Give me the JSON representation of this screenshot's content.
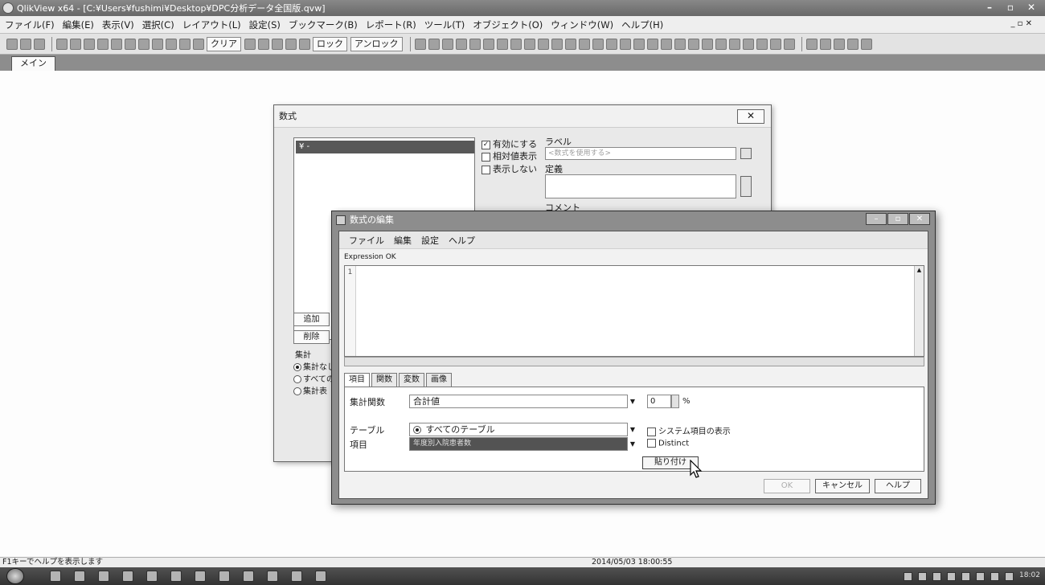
{
  "app": {
    "title": "QlikView x64 - [C:¥Users¥fushimi¥Desktop¥DPC分析データ全国版.qvw]",
    "window_controls": [
      "–",
      "▫",
      "✕"
    ],
    "mdi_controls": "_ ▫ ✕"
  },
  "menu": [
    "ファイル(F)",
    "編集(E)",
    "表示(V)",
    "選択(C)",
    "レイアウト(L)",
    "設定(S)",
    "ブックマーク(B)",
    "レポート(R)",
    "ツール(T)",
    "オブジェクト(O)",
    "ウィンドウ(W)",
    "ヘルプ(H)"
  ],
  "toolbar": {
    "clear_label": "クリア",
    "lock_label": "ロック",
    "unlock_label": "アンロック"
  },
  "sheet_tabs": [
    "メイン"
  ],
  "bg_dialog": {
    "title": "数式",
    "close_label": "✕",
    "list_item": "¥ -",
    "enable_label": "有効にする",
    "relative_label": "相対値表示",
    "hide_label": "表示しない",
    "label_caption": "ラベル",
    "label_placeholder": "<数式を使用する>",
    "definition_caption": "定義",
    "comment_caption": "コメント",
    "add_button": "追加",
    "delete_button": "削除",
    "total_mode_caption": "集計",
    "total_modes": [
      "集計なし",
      "すべての",
      "集計表"
    ]
  },
  "fg_dialog": {
    "title": "数式の編集",
    "menu": [
      "ファイル",
      "編集",
      "設定",
      "ヘルプ"
    ],
    "status": "Expression OK",
    "line_number": "1",
    "tabs": [
      "項目",
      "関数",
      "変数",
      "画像"
    ],
    "aggregation_label": "集計関数",
    "aggregation_value": "合計値",
    "percent_value": "0",
    "percent_unit": "%",
    "table_label": "テーブル",
    "table_value": "すべてのテーブル",
    "field_label": "項目",
    "field_value": "年度別入院患者数",
    "system_fields_label": "システム項目の表示",
    "distinct_label": "Distinct",
    "paste_button": "貼り付け",
    "ok_button": "OK",
    "cancel_button": "キャンセル",
    "help_button": "ヘルプ"
  },
  "statusbar": {
    "hint": "F1キーでヘルプを表示します",
    "timestamp": "2014/05/03 18:00:55"
  },
  "taskbar": {
    "clock": "18:02"
  }
}
